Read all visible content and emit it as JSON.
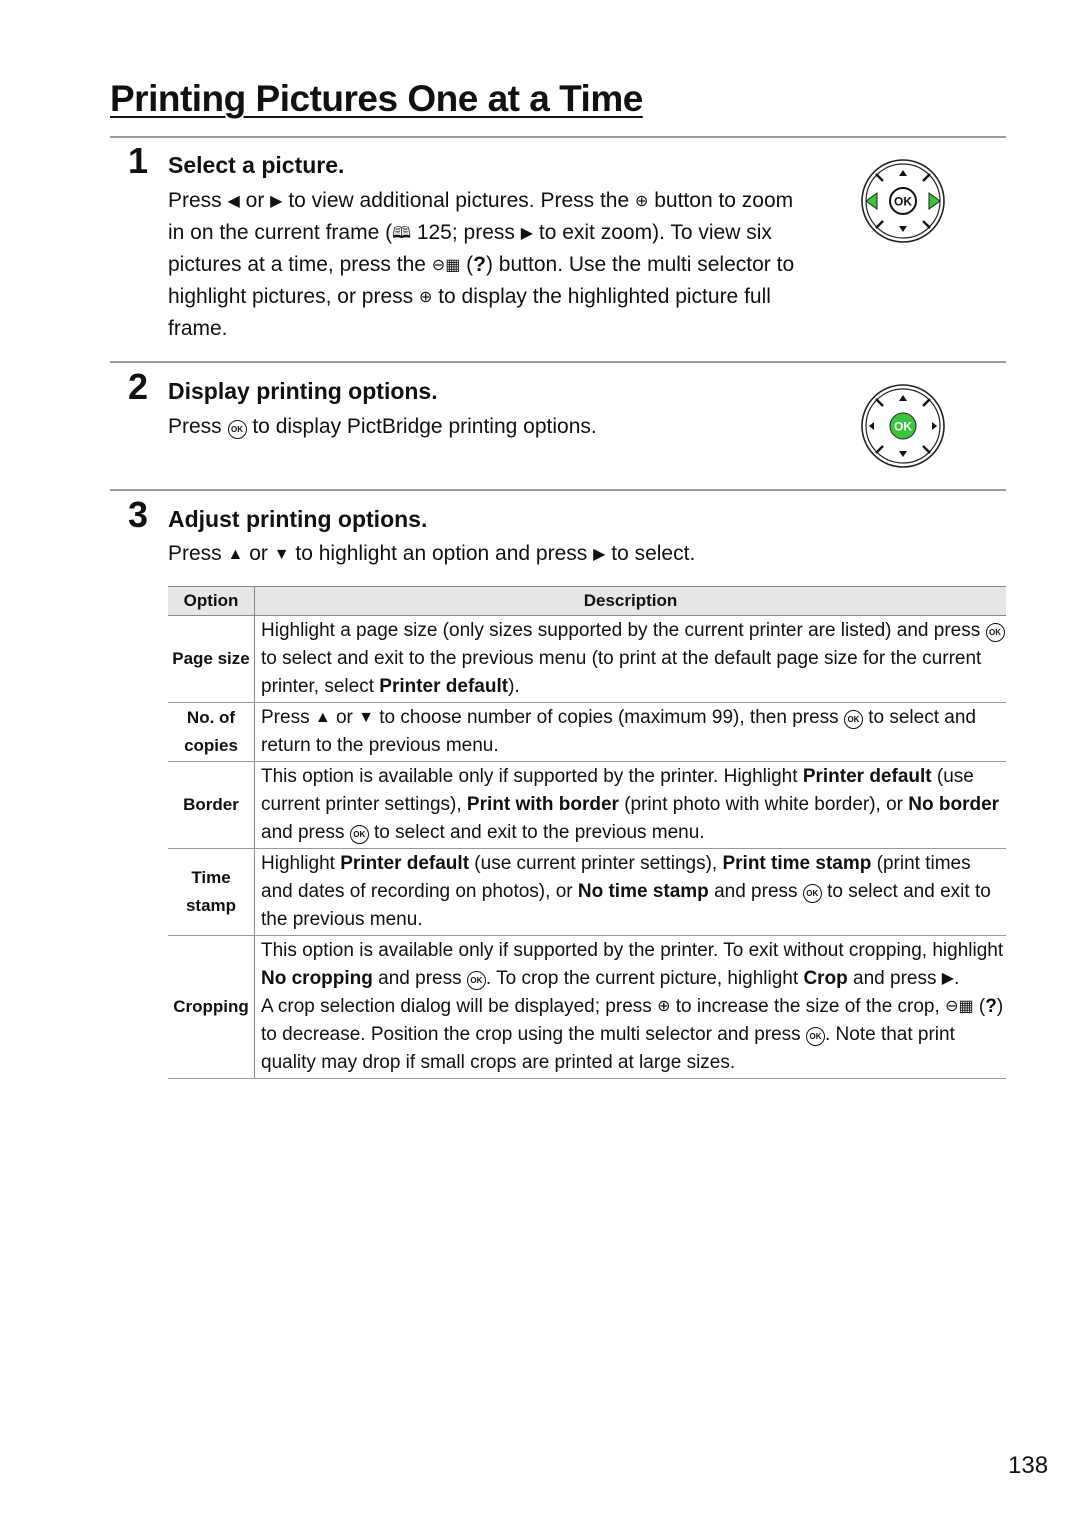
{
  "page": {
    "title": "Printing Pictures One at a Time",
    "page_number": "138"
  },
  "steps": [
    {
      "number": "1",
      "heading": "Select a picture.",
      "body": [
        {
          "t": "Press "
        },
        {
          "icon": "left-arrow-icon",
          "glyph": "◀"
        },
        {
          "t": " or "
        },
        {
          "icon": "right-arrow-icon",
          "glyph": "▶"
        },
        {
          "t": " to view additional pictures.  Press the "
        },
        {
          "icon": "zoom-in-icon",
          "glyph": "⊕"
        },
        {
          "t": " button to zoom in on the current frame ("
        },
        {
          "icon": "book-icon",
          "glyph": "🕮"
        },
        {
          "t": " 125; press "
        },
        {
          "icon": "playback-icon",
          "glyph": "▶"
        },
        {
          "t": " to exit zoom).  To view six pictures at a time, press the "
        },
        {
          "icon": "thumbnail-zoom-out-icon",
          "glyph": "⊖▦"
        },
        {
          "t": " ("
        },
        {
          "b": "?"
        },
        {
          "t": ") button.  Use the multi selector to highlight pictures, or press "
        },
        {
          "icon": "zoom-in-icon",
          "glyph": "⊕"
        },
        {
          "t": " to display the highlighted picture full frame."
        }
      ],
      "selector_highlight": "left-right"
    },
    {
      "number": "2",
      "heading": "Display printing options.",
      "body": [
        {
          "t": "Press "
        },
        {
          "icon": "ok-button-icon",
          "glyph": "OK"
        },
        {
          "t": " to display PictBridge printing options."
        }
      ],
      "selector_highlight": "ok"
    },
    {
      "number": "3",
      "heading": "Adjust printing options.",
      "body": [
        {
          "t": "Press "
        },
        {
          "icon": "up-arrow-icon",
          "glyph": "▲"
        },
        {
          "t": " or "
        },
        {
          "icon": "down-arrow-icon",
          "glyph": "▼"
        },
        {
          "t": " to highlight an option and press "
        },
        {
          "icon": "right-arrow-icon",
          "glyph": "▶"
        },
        {
          "t": " to select."
        }
      ]
    }
  ],
  "selector": {
    "ok_label": "OK",
    "highlight_color": "#3cc43c"
  },
  "table": {
    "headers": {
      "option": "Option",
      "description": "Description"
    },
    "rows": [
      {
        "option": "Page size",
        "description": [
          {
            "t": "Highlight a page size (only sizes supported by the current printer are listed) and press "
          },
          {
            "icon": "ok-button-icon",
            "glyph": "OK"
          },
          {
            "t": " to select and exit to the previous menu (to print at the default page size for the current printer, select "
          },
          {
            "b": "Printer default"
          },
          {
            "t": ")."
          }
        ]
      },
      {
        "option": "No. of copies",
        "description": [
          {
            "t": "Press "
          },
          {
            "icon": "up-arrow-icon",
            "glyph": "▲"
          },
          {
            "t": " or "
          },
          {
            "icon": "down-arrow-icon",
            "glyph": "▼"
          },
          {
            "t": " to choose number of copies (maximum 99), then press "
          },
          {
            "icon": "ok-button-icon",
            "glyph": "OK"
          },
          {
            "t": " to select and return to the previous menu."
          }
        ]
      },
      {
        "option": "Border",
        "description": [
          {
            "t": "This option is available only if supported by the printer.  Highlight "
          },
          {
            "b": "Printer default"
          },
          {
            "t": " (use current printer settings), "
          },
          {
            "b": "Print with border"
          },
          {
            "t": " (print photo with white border), or "
          },
          {
            "b": "No border"
          },
          {
            "t": " and press "
          },
          {
            "icon": "ok-button-icon",
            "glyph": "OK"
          },
          {
            "t": " to select and exit to the previous menu."
          }
        ]
      },
      {
        "option": "Time stamp",
        "description": [
          {
            "t": "Highlight "
          },
          {
            "b": "Printer default"
          },
          {
            "t": " (use current printer settings), "
          },
          {
            "b": "Print time stamp"
          },
          {
            "t": " (print times and dates of recording on photos), or "
          },
          {
            "b": "No time stamp"
          },
          {
            "t": " and press "
          },
          {
            "icon": "ok-button-icon",
            "glyph": "OK"
          },
          {
            "t": " to select and exit to the previous menu."
          }
        ]
      },
      {
        "option": "Cropping",
        "description": [
          {
            "t": "This option is available only if supported by the printer.  To exit without cropping, highlight "
          },
          {
            "b": "No cropping"
          },
          {
            "t": " and press "
          },
          {
            "icon": "ok-button-icon",
            "glyph": "OK"
          },
          {
            "t": ".  To crop the current picture, highlight "
          },
          {
            "b": "Crop"
          },
          {
            "t": " and press "
          },
          {
            "icon": "right-arrow-icon",
            "glyph": "▶"
          },
          {
            "t": "."
          },
          {
            "br": true
          },
          {
            "t": "A crop selection dialog will be displayed; press "
          },
          {
            "icon": "zoom-in-icon",
            "glyph": "⊕"
          },
          {
            "t": " to increase the size of the crop, "
          },
          {
            "icon": "thumbnail-zoom-out-icon",
            "glyph": "⊖▦"
          },
          {
            "t": " ("
          },
          {
            "b": "?"
          },
          {
            "t": ") to decrease.  Position the crop using the multi selector and press "
          },
          {
            "icon": "ok-button-icon",
            "glyph": "OK"
          },
          {
            "t": ".  Note that print quality may drop if small crops are printed at large sizes."
          }
        ]
      }
    ]
  }
}
